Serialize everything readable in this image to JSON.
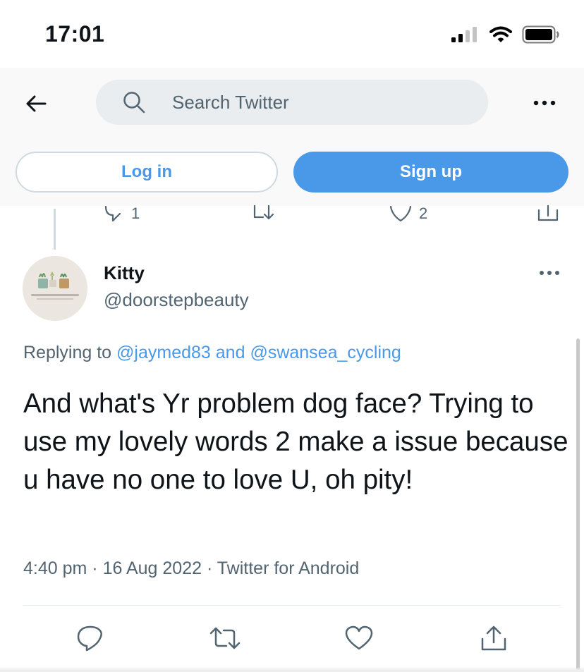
{
  "status_bar": {
    "time": "17:01"
  },
  "header": {
    "search_placeholder": "Search Twitter",
    "login_label": "Log in",
    "signup_label": "Sign up"
  },
  "previous_tweet": {
    "reply_count": "1",
    "like_count": "2"
  },
  "tweet": {
    "author_name": "Kitty",
    "author_handle": "@doorstepbeauty",
    "replying_prefix": "Replying to",
    "replying_mention_1": "@jaymed83",
    "replying_and": "and",
    "replying_mention_2": "@swansea_cycling",
    "text": "And what's Yr problem dog face? Trying to use my lovely words 2 make a issue because u have no one to love U, oh pity!",
    "time": "4:40 pm",
    "date": "16 Aug 2022",
    "source": "Twitter for Android",
    "separator": "·"
  },
  "icons": {
    "back": "back-arrow-icon",
    "search": "search-icon",
    "more": "more-horizontal-icon",
    "reply": "reply-icon",
    "retweet": "retweet-icon",
    "like": "heart-icon",
    "share": "share-icon"
  },
  "colors": {
    "accent": "#4a99e9",
    "text_primary": "#0f1419",
    "text_secondary": "#536471",
    "header_bg": "#f9f9f9",
    "search_bg": "#e9edef"
  }
}
